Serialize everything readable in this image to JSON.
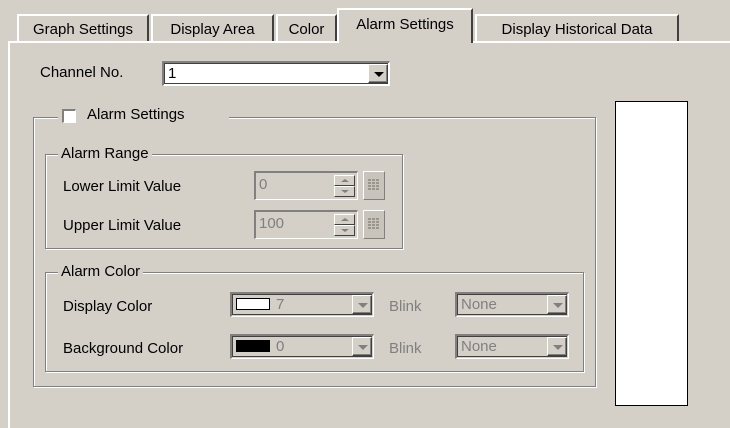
{
  "tabs": [
    {
      "label": "Graph Settings"
    },
    {
      "label": "Display Area"
    },
    {
      "label": "Color"
    },
    {
      "label": "Alarm Settings"
    },
    {
      "label": "Display Historical Data"
    }
  ],
  "active_tab": "Alarm Settings",
  "channel": {
    "label": "Channel No.",
    "value": "1"
  },
  "alarm_settings": {
    "label": "Alarm Settings",
    "checked": false
  },
  "alarm_range": {
    "title": "Alarm Range",
    "lower": {
      "label": "Lower Limit Value",
      "value": "0"
    },
    "upper": {
      "label": "Upper Limit Value",
      "value": "100"
    }
  },
  "alarm_color": {
    "title": "Alarm Color",
    "display": {
      "label": "Display Color",
      "value": "7",
      "swatch": "#ffffff",
      "blink_label": "Blink",
      "blink_value": "None"
    },
    "background": {
      "label": "Background Color",
      "value": "0",
      "swatch": "#000000",
      "blink_label": "Blink",
      "blink_value": "None"
    }
  },
  "colors": {
    "dialog_bg": "#d4d0c8",
    "disabled_text": "#808080"
  }
}
